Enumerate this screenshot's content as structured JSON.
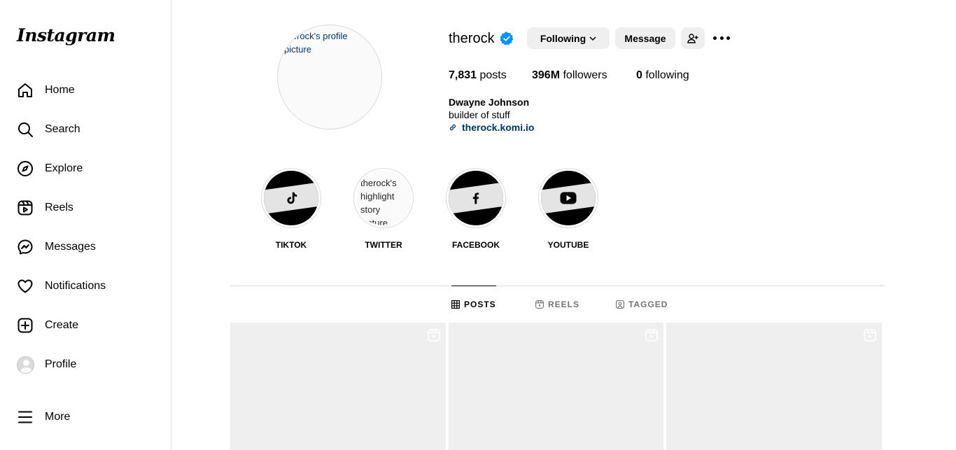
{
  "sidebar": {
    "logo": "Instagram",
    "items": [
      {
        "label": "Home",
        "icon": "home-icon"
      },
      {
        "label": "Search",
        "icon": "search-icon"
      },
      {
        "label": "Explore",
        "icon": "compass-icon"
      },
      {
        "label": "Reels",
        "icon": "reels-icon"
      },
      {
        "label": "Messages",
        "icon": "messenger-icon"
      },
      {
        "label": "Notifications",
        "icon": "heart-icon"
      },
      {
        "label": "Create",
        "icon": "plus-square-icon"
      },
      {
        "label": "Profile",
        "icon": "avatar"
      },
      {
        "label": "More",
        "icon": "menu-icon"
      }
    ]
  },
  "profile": {
    "picture_alt": "therock's profile picture",
    "username": "therock",
    "verified": true,
    "following_button": "Following",
    "message_button": "Message",
    "stats": {
      "posts_count": "7,831",
      "posts_label": "posts",
      "followers_count": "396M",
      "followers_label": "followers",
      "following_count": "0",
      "following_label": "following"
    },
    "full_name": "Dwayne Johnson",
    "bio": "builder of stuff",
    "link": "therock.komi.io"
  },
  "highlights": [
    {
      "label": "TIKTOK",
      "icon": "tiktok-icon"
    },
    {
      "label": "TWITTER",
      "alt": "therock's highlight story picture"
    },
    {
      "label": "FACEBOOK",
      "icon": "facebook-icon"
    },
    {
      "label": "YOUTUBE",
      "icon": "youtube-icon"
    }
  ],
  "tabs": [
    {
      "label": "POSTS",
      "active": true
    },
    {
      "label": "REELS",
      "active": false
    },
    {
      "label": "TAGGED",
      "active": false
    }
  ],
  "colors": {
    "verified_blue": "#0095f6",
    "link_blue": "#00376b",
    "button_gray": "#efefef",
    "border": "#dbdbdb"
  }
}
